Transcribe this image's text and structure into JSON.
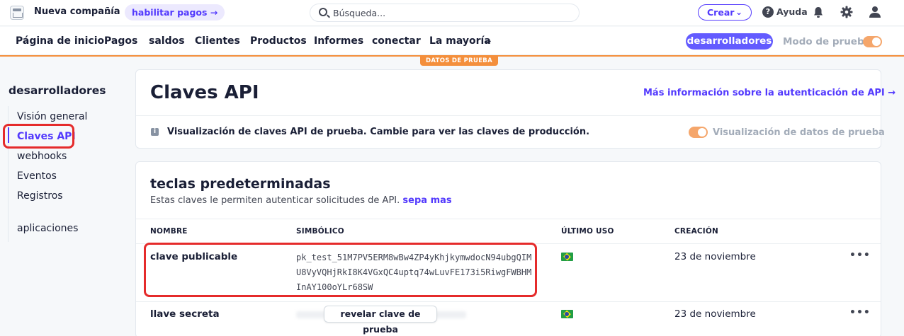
{
  "topbar": {
    "company_name": "Nueva compañía",
    "enable_payments": "habilitar pagos",
    "search_placeholder": "Búsqueda...",
    "create_label": "Crear",
    "help_label": "Ayuda"
  },
  "nav": {
    "items": [
      "Página de inicio",
      "Pagos",
      "saldos",
      "Clientes",
      "Productos",
      "Informes",
      "conectar",
      "La mayoría"
    ],
    "developers": "desarrolladores",
    "test_mode": "Modo de prueba",
    "test_banner": "DATOS DE PRUEBA"
  },
  "sidebar": {
    "title": "desarrolladores",
    "items": [
      "Visión general",
      "Claves API",
      "webhooks",
      "Eventos",
      "Registros",
      "aplicaciones"
    ],
    "active_index": 1
  },
  "header": {
    "title": "Claves API",
    "learn_more": "Más información sobre la autenticación de API →"
  },
  "notice": {
    "text": "Visualización de claves API de prueba. Cambie para ver las claves de producción.",
    "toggle_label": "Visualización de datos de prueba"
  },
  "keys_section": {
    "title": "teclas predeterminadas",
    "description": "Estas claves le permiten autenticar solicitudes de API.",
    "learn_link": "sepa mas",
    "columns": [
      "NOMBRE",
      "SIMBÓLICO",
      "ÚLTIMO USO",
      "CREACIÓN"
    ],
    "rows": [
      {
        "name": "clave publicable",
        "token": "pk_test_51M7PV5ERM8wBw4ZP4yKhjkymwdocN94ubgQIMU8VyVQHjRkI8K4VGxQC4uptq74wLuvFE173i5RiwgFWBHMInAY100oYLr68SW",
        "last_used": "brazil-flag-icon",
        "created": "23 de noviembre"
      },
      {
        "name": "llave secreta",
        "reveal_label": "revelar clave de prueba",
        "last_used": "brazil-flag-icon",
        "created": "23 de noviembre"
      }
    ]
  },
  "colors": {
    "accent": "#533afd",
    "test_orange": "#f48f3c",
    "annotation_red": "#e52b2b"
  }
}
